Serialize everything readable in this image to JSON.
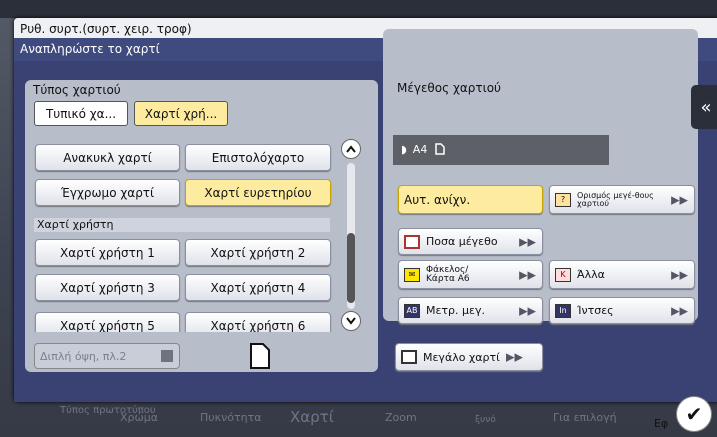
{
  "background": {
    "tabs": [
      "Τύπος πρωτοτύπου",
      "Χρώμα",
      "Πυκνότητα",
      "Χαρτί",
      "Zoom",
      "ξυνό",
      "Για επιλογή",
      "Εφ"
    ]
  },
  "dialog": {
    "title": "Ρυθ. συρτ.(συρτ. χειρ. τροφ)",
    "subtitle": "Αναπληρώστε το χαρτί"
  },
  "paper_type": {
    "title": "Τύπος χαρτιού",
    "tabs": [
      "Τυπικό χα...",
      "Χαρτί χρή..."
    ],
    "buttons": [
      "Ανακυκλ χαρτί",
      "Επιστολόχαρτο",
      "Έγχρωμο χαρτί",
      "Χαρτί ευρετηρίου"
    ],
    "section_label": "Χαρτί χρήστη",
    "user_buttons": [
      "Χαρτί χρήστη 1",
      "Χαρτί χρήστη 2",
      "Χαρτί χρήστη 3",
      "Χαρτί χρήστη 4",
      "Χαρτί χρήστη 5",
      "Χαρτί χρήστη 6"
    ],
    "duplex_label": "Διπλή όψη, πλ.2"
  },
  "paper_size": {
    "title": "Μέγεθος χαρτιού",
    "current": "A4",
    "auto_detect": "Αυτ. ανίχν.",
    "custom_size": "Ορισμός μεγέ-θους χαρτιού",
    "photo_size": "Ποσα μέγεθο",
    "envelope": "Φάκελος/ Κάρτα A6",
    "other": "Άλλα",
    "measure": "Μετρ. μεγ.",
    "inch": "Ίντσες",
    "large_paper": "Μεγάλο χαρτί"
  },
  "icons": {
    "collapse": "«",
    "ok": "✔",
    "arrow": "▶▶",
    "up": "⌃",
    "down": "⌄"
  }
}
